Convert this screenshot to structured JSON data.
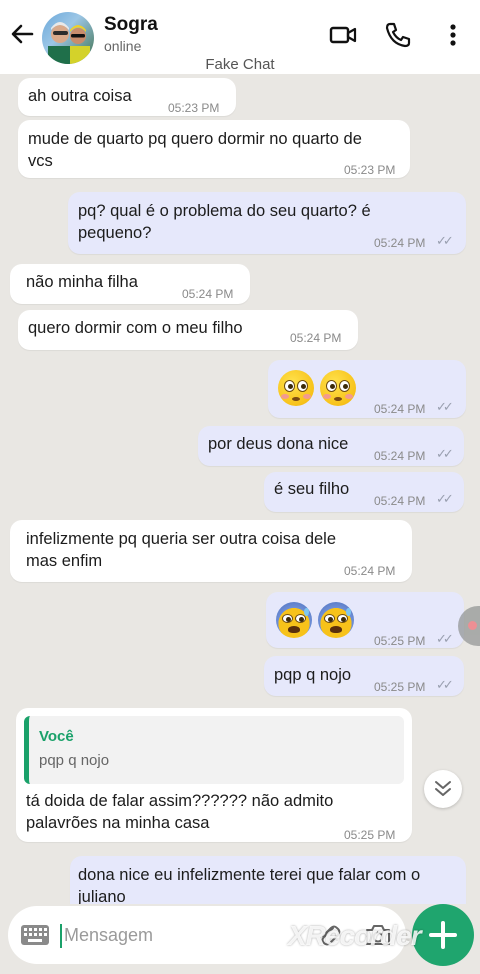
{
  "header": {
    "contact_name": "Sogra",
    "status": "online",
    "caption": "Fake Chat"
  },
  "messages": [
    {
      "dir": "in",
      "text": "ah outra coisa",
      "time": "05:23 PM"
    },
    {
      "dir": "in",
      "text_lines": [
        "mude de quarto pq quero dormir no quarto de",
        "vcs"
      ],
      "time": "05:23 PM"
    },
    {
      "dir": "out",
      "text_lines": [
        "pq? qual é o problema do seu quarto? é",
        "pequeno?"
      ],
      "time": "05:24 PM"
    },
    {
      "dir": "in",
      "text": "não minha filha",
      "time": "05:24 PM"
    },
    {
      "dir": "in",
      "text": "quero dormir com o meu filho",
      "time": "05:24 PM"
    },
    {
      "dir": "out",
      "emoji": "flushed-face x2",
      "time": "05:24 PM"
    },
    {
      "dir": "out",
      "text": "por deus dona nice",
      "time": "05:24 PM"
    },
    {
      "dir": "out",
      "text": "é seu filho",
      "time": "05:24 PM"
    },
    {
      "dir": "in",
      "text_lines": [
        "infelizmente pq queria ser outra coisa dele",
        "mas enfim"
      ],
      "time": "05:24 PM"
    },
    {
      "dir": "out",
      "emoji": "anxious-face-with-sweat x2",
      "time": "05:25 PM"
    },
    {
      "dir": "out",
      "text": "pqp q nojo",
      "time": "05:25 PM"
    },
    {
      "dir": "in",
      "quote_author": "Você",
      "quote_text": "pqp q nojo",
      "text_lines": [
        "tá doida de falar assim?????? não admito",
        "palavrões na minha casa"
      ],
      "time": "05:25 PM"
    },
    {
      "dir": "out",
      "text_lines": [
        "dona nice eu infelizmente terei que falar com o",
        "juliano"
      ]
    }
  ],
  "input": {
    "placeholder": "Mensagem"
  },
  "watermark": "XRecorder",
  "colors": {
    "outgoing_bubble": "#e6e8fb",
    "incoming_bubble": "#ffffff",
    "accent_green": "#1fa56e",
    "chat_background": "#e9e7e3"
  }
}
